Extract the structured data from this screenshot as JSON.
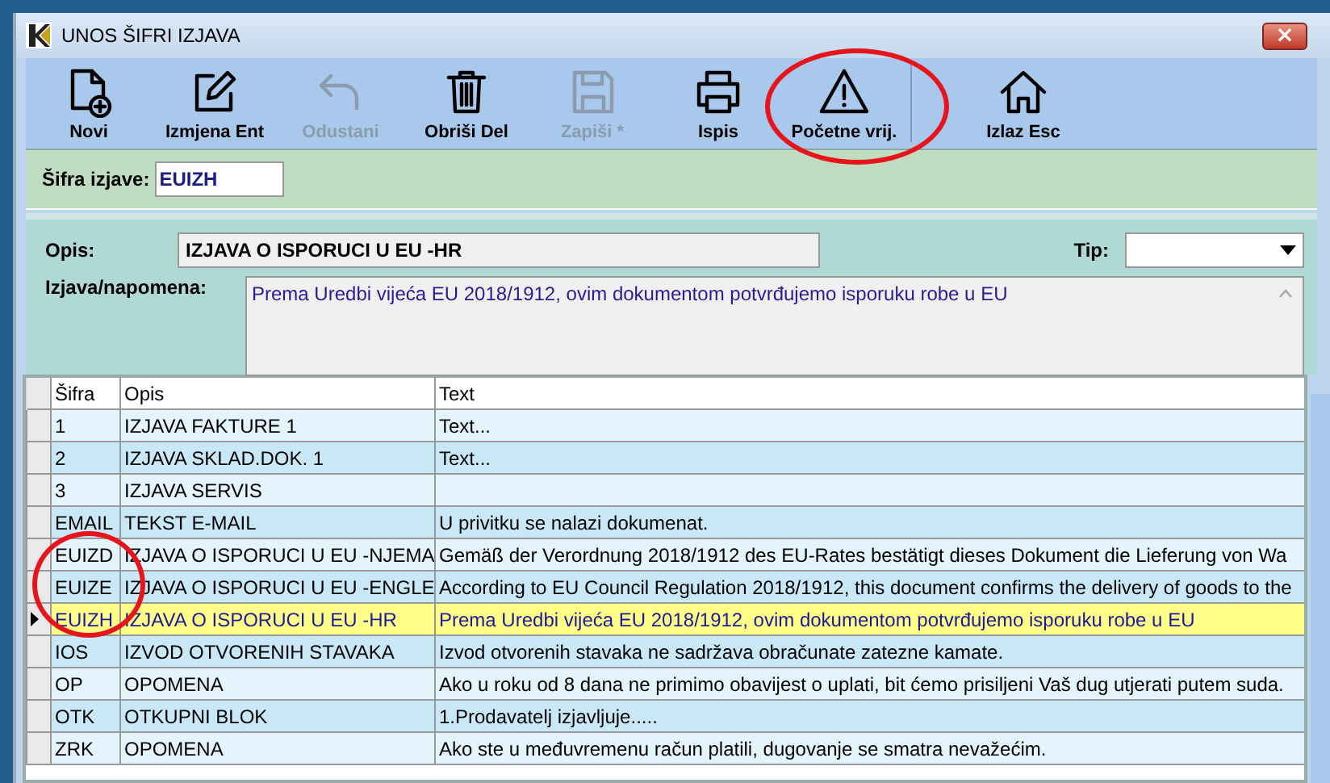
{
  "window": {
    "title": "UNOS ŠIFRI IZJAVA",
    "close": "×"
  },
  "toolbar": [
    {
      "label": "Novi",
      "kind": "new",
      "disabled": false,
      "circled": false
    },
    {
      "label": "Izmjena Ent",
      "kind": "edit",
      "disabled": false,
      "circled": false
    },
    {
      "label": "Odustani",
      "kind": "undo",
      "disabled": true,
      "circled": false
    },
    {
      "label": "Obriši Del",
      "kind": "trash",
      "disabled": false,
      "circled": false
    },
    {
      "label": "Zapiši *",
      "kind": "save",
      "disabled": true,
      "circled": false
    },
    {
      "label": "Ispis",
      "kind": "print",
      "disabled": false,
      "circled": false
    },
    {
      "label": "Početne vrij.",
      "kind": "warning",
      "disabled": false,
      "circled": true
    },
    {
      "label": "Izlaz Esc",
      "kind": "home",
      "disabled": false,
      "circled": false,
      "separated": true
    }
  ],
  "code_field": {
    "label": "Šifra izjave:",
    "value": "EUIZH"
  },
  "description_field": {
    "label": "Opis:",
    "value": "IZJAVA O ISPORUCI U EU -HR"
  },
  "type_field": {
    "label": "Tip:"
  },
  "note_field": {
    "label": "Izjava/napomena:",
    "value": "Prema Uredbi vijeća EU 2018/1912, ovim dokumentom potvrđujemo isporuku robe u EU"
  },
  "table": {
    "columns": [
      "Šifra",
      "Opis",
      "Text"
    ],
    "rows": [
      {
        "cells": [
          "1",
          "IZJAVA FAKTURE 1",
          "Text..."
        ],
        "selected": false,
        "circled": false
      },
      {
        "cells": [
          "2",
          "IZJAVA SKLAD.DOK. 1",
          "Text..."
        ],
        "selected": false,
        "circled": false
      },
      {
        "cells": [
          "3",
          "IZJAVA SERVIS",
          ""
        ],
        "selected": false,
        "circled": false
      },
      {
        "cells": [
          "EMAIL",
          "TEKST E-MAIL",
          " U privitku se nalazi dokumenat."
        ],
        "selected": false,
        "circled": false
      },
      {
        "cells": [
          "EUIZD",
          "IZJAVA O ISPORUCI U EU -NJEMA",
          "Gemäß der Verordnung 2018/1912 des EU-Rates bestätigt dieses Dokument die Lieferung von Wa"
        ],
        "selected": false,
        "circled": false
      },
      {
        "cells": [
          "EUIZE",
          "IZJAVA O ISPORUCI U EU -ENGLE",
          "According to EU Council Regulation 2018/1912, this document confirms the delivery of goods to the"
        ],
        "selected": false,
        "circled": true
      },
      {
        "cells": [
          "EUIZH",
          "IZJAVA O ISPORUCI U EU -HR",
          "Prema Uredbi vijeća EU 2018/1912, ovim dokumentom potvrđujemo isporuku robe u EU"
        ],
        "selected": true,
        "circled": false
      },
      {
        "cells": [
          "IOS",
          "IZVOD OTVORENIH STAVAKA",
          "Izvod otvorenih stavaka ne sadržava obračunate zatezne kamate."
        ],
        "selected": false,
        "circled": false
      },
      {
        "cells": [
          "OP",
          "OPOMENA",
          "Ako u roku od 8 dana ne primimo obavijest o uplati, bit ćemo prisiljeni Vaš dug utjerati putem suda."
        ],
        "selected": false,
        "circled": false
      },
      {
        "cells": [
          "OTK",
          "OTKUPNI BLOK",
          "1.Prodavatelj izjavljuje....."
        ],
        "selected": false,
        "circled": false
      },
      {
        "cells": [
          "ZRK",
          "OPOMENA",
          "Ako ste u međuvremenu račun platili, dugovanje se smatra nevažećim."
        ],
        "selected": false,
        "circled": false
      }
    ]
  }
}
